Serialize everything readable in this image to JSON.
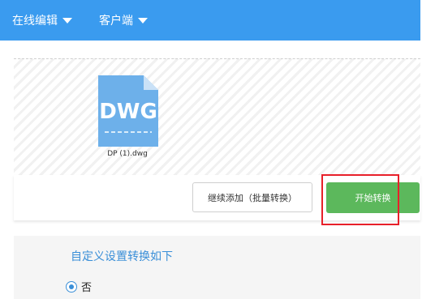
{
  "header": {
    "nav": [
      {
        "label": "在线编辑",
        "icon": "chevron-down-icon"
      },
      {
        "label": "客户端",
        "icon": "chevron-down-icon"
      }
    ],
    "background": "#3a9bef"
  },
  "upload": {
    "file": {
      "type_label": "DWG",
      "name": "DP (1).dwg",
      "icon": "dwg-file-icon",
      "icon_color": "#6db0ea"
    }
  },
  "actions": {
    "batch_label": "继续添加（批量转换）",
    "start_label": "开始转换",
    "start_color": "#5cb85c",
    "highlight_color": "#e8202a"
  },
  "settings": {
    "title": "自定义设置转换如下",
    "option_label": "否",
    "option_selected": true
  }
}
